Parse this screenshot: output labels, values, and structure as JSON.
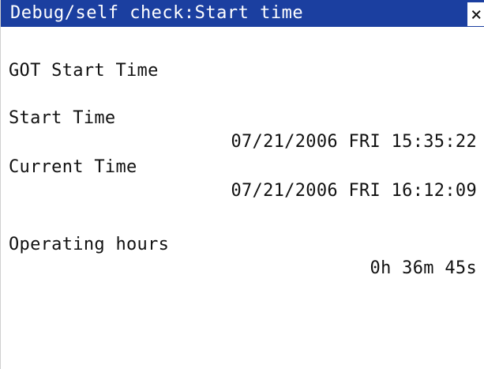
{
  "window": {
    "title": "Debug/self check:Start time",
    "close_label": "×"
  },
  "content": {
    "heading": "GOT Start Time",
    "start_time_label": "Start Time",
    "start_time_value": "07/21/2006 FRI 15:35:22",
    "current_time_label": "Current Time",
    "current_time_value": "07/21/2006 FRI 16:12:09",
    "operating_hours_label": "Operating hours",
    "operating_hours_value": "0h 36m 45s"
  }
}
